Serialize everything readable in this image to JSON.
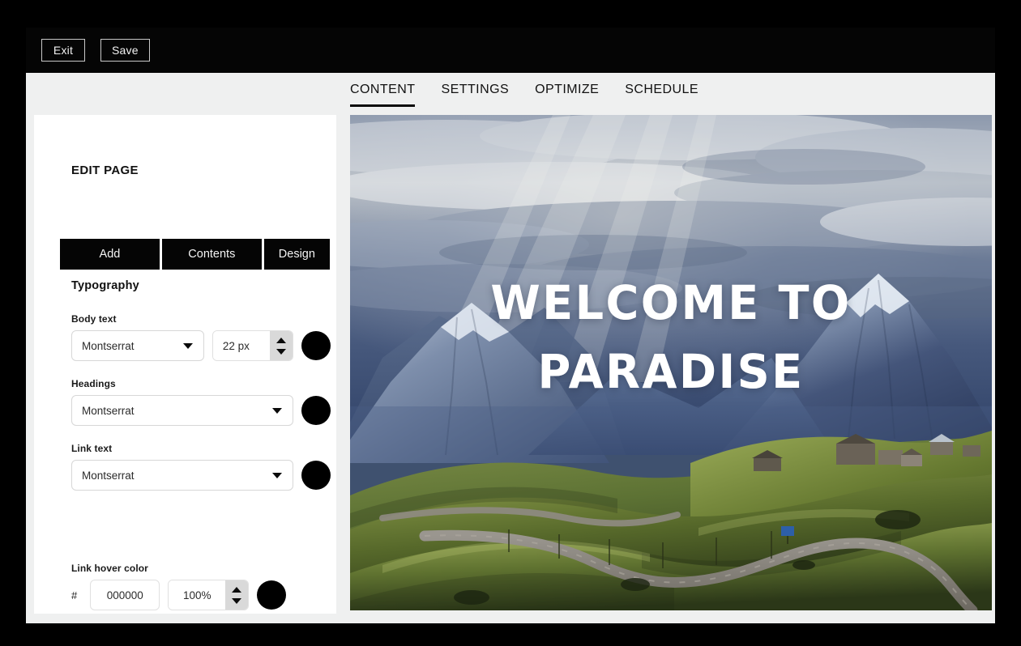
{
  "toolbar": {
    "exit_label": "Exit",
    "save_label": "Save"
  },
  "tabs": [
    {
      "label": "CONTENT",
      "active": true
    },
    {
      "label": "SETTINGS",
      "active": false
    },
    {
      "label": "OPTIMIZE",
      "active": false
    },
    {
      "label": "SCHEDULE",
      "active": false
    }
  ],
  "sidebar": {
    "title": "EDIT PAGE",
    "segmented": [
      {
        "label": "Add"
      },
      {
        "label": "Contents"
      },
      {
        "label": "Design"
      }
    ],
    "typography": {
      "section_title": "Typography",
      "body_text": {
        "label": "Body text",
        "font": "Montserrat",
        "size": "22 px",
        "color": "#000000"
      },
      "headings": {
        "label": "Headings",
        "font": "Montserrat",
        "color": "#000000"
      },
      "link_text": {
        "label": "Link text",
        "font": "Montserrat",
        "color": "#000000"
      },
      "link_hover_color": {
        "label": "Link hover color",
        "hash": "#",
        "hex": "000000",
        "opacity": "100%",
        "color": "#000000"
      }
    }
  },
  "preview": {
    "heading_line1": "WELCOME TO",
    "heading_line2": "PARADISE",
    "alt": "mountain-landscape-with-winding-road"
  },
  "colors": {
    "frame": "#000000",
    "page_surface": "#eff0f0",
    "toolbar": "#050505",
    "panel": "#ffffff",
    "accent": "#000000"
  }
}
